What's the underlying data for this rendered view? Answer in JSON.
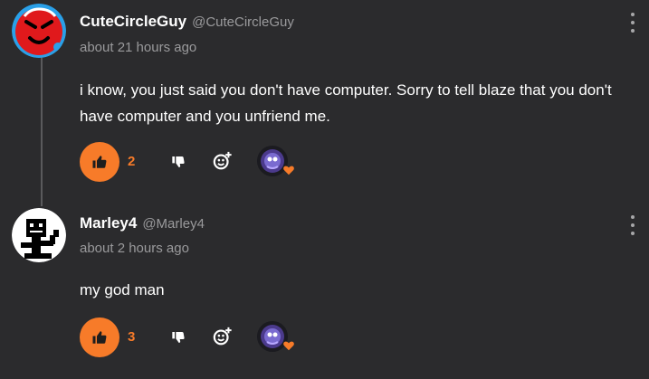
{
  "comments": [
    {
      "author": "CuteCircleGuy",
      "handle": "@CuteCircleGuy",
      "time": "about 21 hours ago",
      "text": "i know, you just said you don't have computer. Sorry to tell blaze that you don't have computer and you unfriend me.",
      "likes": "2",
      "avatar_icon": "red-circle-face-avatar",
      "reaction_icon": "heart-icon"
    },
    {
      "author": "Marley4",
      "handle": "@Marley4",
      "time": "about 2 hours ago",
      "text": "my god man",
      "likes": "3",
      "avatar_icon": "black-pixel-creature-avatar",
      "reaction_icon": "heart-icon"
    }
  ],
  "colors": {
    "background": "#2b2b2d",
    "accent": "#f77b29",
    "text": "#ffffff",
    "muted": "#9a9a9c",
    "avatar_red": "#e0191c",
    "avatar_blue": "#2aa0e8"
  }
}
